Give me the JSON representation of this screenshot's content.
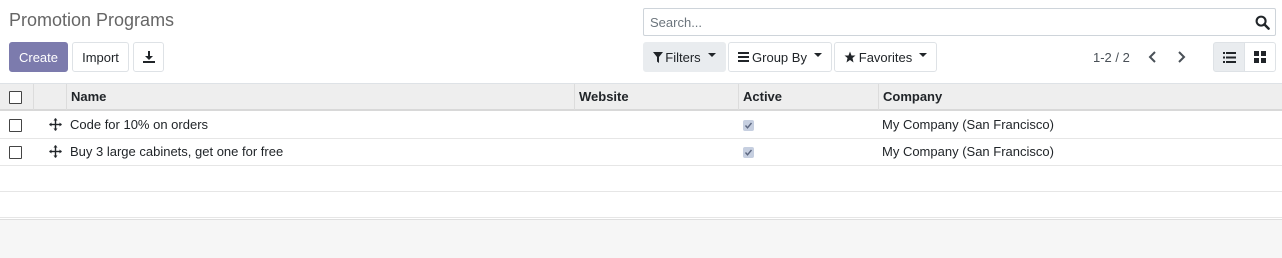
{
  "page": {
    "title": "Promotion Programs"
  },
  "search": {
    "placeholder": "Search..."
  },
  "toolbar": {
    "create_label": "Create",
    "import_label": "Import",
    "filters_label": "Filters",
    "groupby_label": "Group By",
    "favorites_label": "Favorites"
  },
  "pager": {
    "text": "1-2 / 2"
  },
  "table": {
    "columns": [
      "Name",
      "Website",
      "Active",
      "Company"
    ],
    "rows": [
      {
        "name": "Code for 10% on orders",
        "website": "",
        "active": true,
        "company": "My Company (San Francisco)"
      },
      {
        "name": "Buy 3 large cabinets, get one for free",
        "website": "",
        "active": true,
        "company": "My Company (San Francisco)"
      }
    ]
  },
  "icons": {
    "search": "search-icon",
    "download": "download-icon",
    "filter": "filter-icon",
    "groupby": "bars-icon",
    "favorites": "star-icon",
    "prev": "chevron-left-icon",
    "next": "chevron-right-icon",
    "list_view": "list-view-icon",
    "kanban_view": "kanban-view-icon",
    "drag_handle": "drag-handle-icon"
  },
  "colors": {
    "primary": "#7c7bad",
    "active_check": "#c6cfe0"
  }
}
